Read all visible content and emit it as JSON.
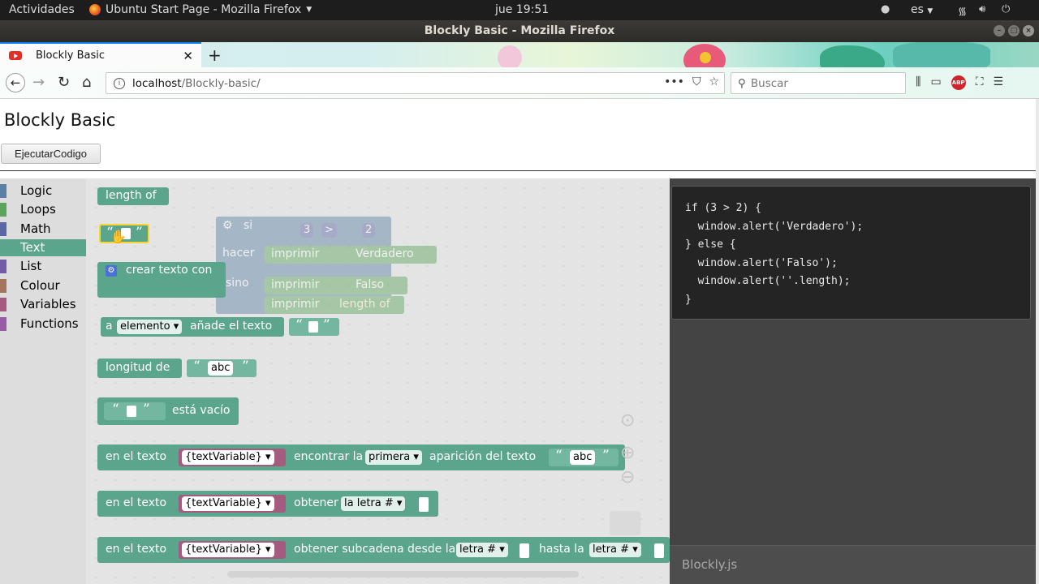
{
  "system_panel": {
    "activities": "Actividades",
    "app_name": "Ubuntu Start Page - Mozilla Firefox",
    "clock": "jue 19:51",
    "language": "es"
  },
  "window": {
    "title": "Blockly Basic - Mozilla Firefox"
  },
  "browser": {
    "tab_title": "Blockly Basic",
    "url_host": "localhost",
    "url_path": "/Blockly-basic/",
    "search_placeholder": "Buscar",
    "abp_label": "ABP"
  },
  "page": {
    "title": "Blockly Basic",
    "run_button": "EjecutarCodigo"
  },
  "toolbox": {
    "categories": [
      {
        "label": "Logic",
        "color": "#5b80a5"
      },
      {
        "label": "Loops",
        "color": "#5ba55b"
      },
      {
        "label": "Math",
        "color": "#5b67a5"
      },
      {
        "label": "Text",
        "color": "#5ba58c"
      },
      {
        "label": "List",
        "color": "#745ba5"
      },
      {
        "label": "Colour",
        "color": "#a5745b"
      },
      {
        "label": "Variables",
        "color": "#a55b80"
      },
      {
        "label": "Functions",
        "color": "#995ba5"
      }
    ],
    "selected": "Text"
  },
  "flyout": {
    "length_of": "length of",
    "create_text": "crear texto con",
    "append_a": "a",
    "append_var": "elemento",
    "append_text": "añade el texto",
    "length_label": "longitud de",
    "length_value": "abc",
    "is_empty": "está vacío",
    "in_text": "en el texto",
    "text_variable": "{textVariable}",
    "find_label": "encontrar la",
    "find_option": "primera",
    "find_occurrence": "aparición del texto",
    "find_value": "abc",
    "get_label": "obtener",
    "letter_option": "la letra #",
    "substring_label": "obtener subcadena desde la",
    "substring_from": "letra #",
    "substring_to_label": "hasta la",
    "substring_to": "letra #"
  },
  "ghost_blocks": {
    "if_label": "si",
    "num_a": "3",
    "op": ">",
    "num_b": "2",
    "do_label": "hacer",
    "print1": "imprimir",
    "true_text": "Verdadero",
    "else_label": "sino",
    "print2": "imprimir",
    "false_text": "Falso",
    "print3": "imprimir",
    "length_of": "length of"
  },
  "code": {
    "lines": [
      "if (3 > 2) {",
      "  window.alert('Verdadero');",
      "} else {",
      "  window.alert('Falso');",
      "  window.alert(''.length);",
      "}"
    ],
    "footer": "Blockly.js"
  }
}
